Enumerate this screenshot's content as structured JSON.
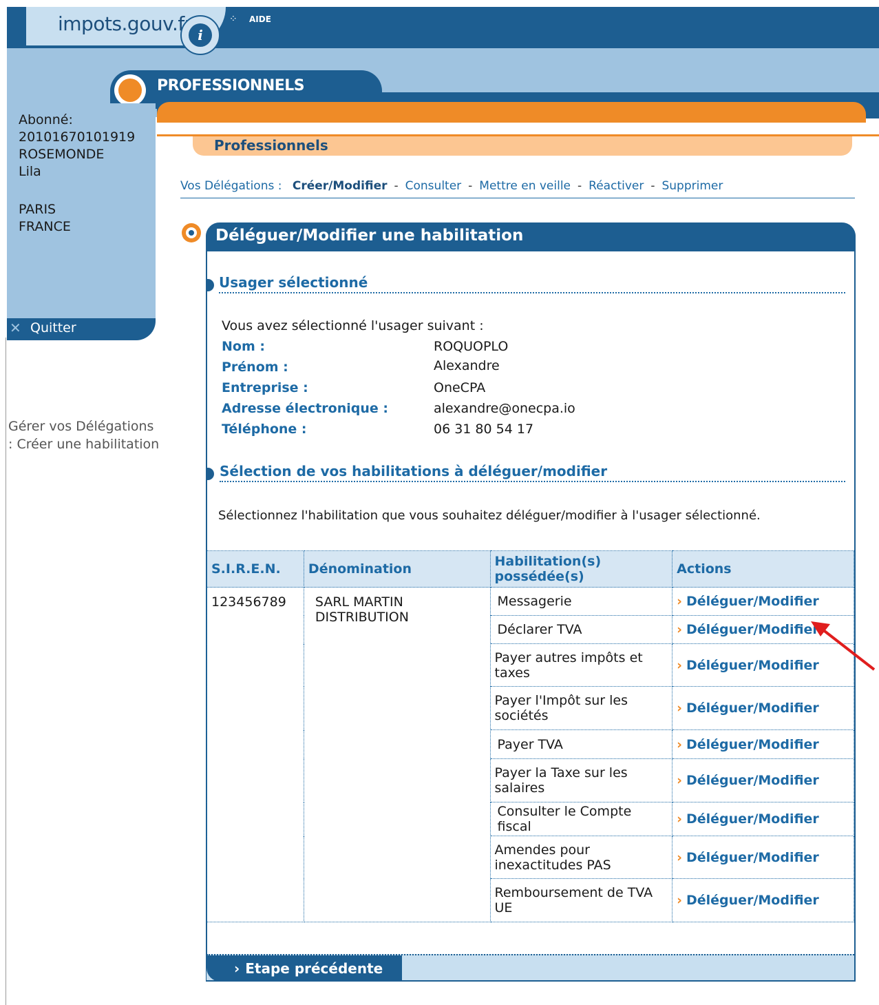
{
  "header": {
    "site_name": "impots.gouv.fr",
    "help_label": "AIDE",
    "space_label": "PROFESSIONNELS",
    "section_label": "Professionnels"
  },
  "sidebar": {
    "subscriber_label": "Abonné:",
    "subscriber_id": "20101670101919",
    "last_name": "ROSEMONDE",
    "first_name": "Lila",
    "city": "PARIS",
    "country": "FRANCE",
    "quit_label": "Quitter",
    "breadcrumb_line1": "Gérer vos Délégations",
    "breadcrumb_line2": ": Créer une habilitation"
  },
  "delegations_nav": {
    "prefix": "Vos Délégations :",
    "items": [
      "Créer/Modifier",
      "Consulter",
      "Mettre en veille",
      "Réactiver",
      "Supprimer"
    ]
  },
  "panel": {
    "title": "Déléguer/Modifier une habilitation",
    "section1_title": "Usager sélectionné",
    "intro": "Vous avez sélectionné l'usager suivant :",
    "user": [
      {
        "label": "Nom :",
        "value": "ROQUOPLO"
      },
      {
        "label": "Prénom :",
        "value": "Alexandre"
      },
      {
        "label": "Entreprise :",
        "value": "OneCPA"
      },
      {
        "label": "Adresse électronique :",
        "value": "alexandre@onecpa.io"
      },
      {
        "label": "Téléphone :",
        "value": "06 31 80 54 17"
      }
    ],
    "section2_title": "Sélection de vos habilitations à déléguer/modifier",
    "instruction": "Sélectionnez l'habilitation que vous souhaitez déléguer/modifier à l'usager sélectionné.",
    "table": {
      "headers": [
        "S.I.R.E.N.",
        "Dénomination",
        "Habilitation(s) possédée(s)",
        "Actions"
      ],
      "siren": "123456789",
      "denomination": "SARL MARTIN DISTRIBUTION",
      "rows": [
        {
          "habilitation": "Messagerie",
          "action": "Déléguer/Modifier"
        },
        {
          "habilitation": "Déclarer TVA",
          "action": "Déléguer/Modifier"
        },
        {
          "habilitation": "Payer autres impôts et taxes",
          "action": "Déléguer/Modifier"
        },
        {
          "habilitation": "Payer l'Impôt sur les sociétés",
          "action": "Déléguer/Modifier"
        },
        {
          "habilitation": "Payer TVA",
          "action": "Déléguer/Modifier"
        },
        {
          "habilitation": "Payer la Taxe sur les salaires",
          "action": "Déléguer/Modifier"
        },
        {
          "habilitation": "Consulter le Compte fiscal",
          "action": "Déléguer/Modifier"
        },
        {
          "habilitation": "Amendes pour inexactitudes PAS",
          "action": "Déléguer/Modifier"
        },
        {
          "habilitation": "Remboursement de TVA UE",
          "action": "Déléguer/Modifier"
        }
      ]
    },
    "prev_button": "Etape précédente"
  },
  "colors": {
    "primary_blue": "#1d5e91",
    "link_blue": "#1d6aa5",
    "orange": "#ef8b27",
    "light_blue": "#9fc3e0",
    "annotation_red": "#e01e1e"
  }
}
